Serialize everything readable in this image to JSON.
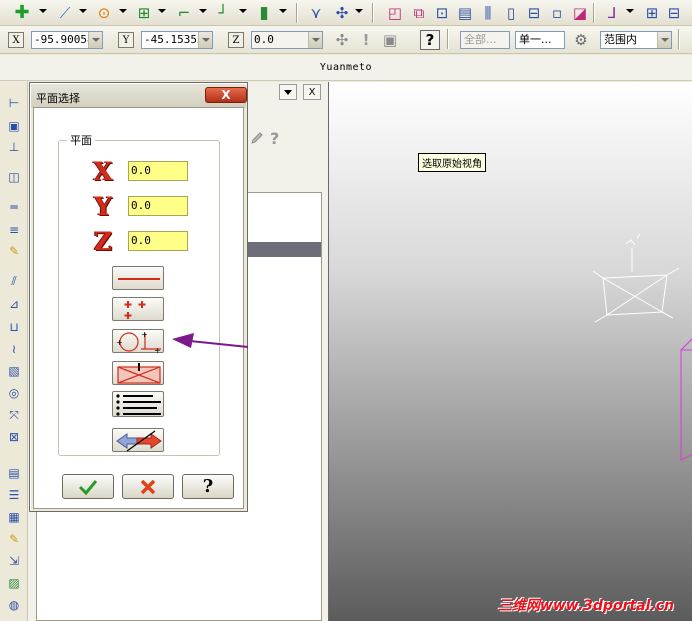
{
  "app": {
    "title": "Yuanmeto"
  },
  "toolbar1": {
    "icons": [
      "add-point-icon",
      "line-icon",
      "circle-icon",
      "grid-icon",
      "curve-icon",
      "path-icon",
      "cylinder-icon",
      "tool-icon",
      "axis-icon",
      "copy-icon",
      "transform-icon",
      "array-icon",
      "align-icon",
      "bar-icon",
      "move-icon",
      "group-icon",
      "mirror-icon",
      "corner-icon",
      "layout-icon",
      "window-icon"
    ]
  },
  "coordinates": {
    "x_label": "X",
    "x_value": "-95.90058",
    "y_label": "Y",
    "y_value": "-45.15353",
    "z_label": "Z",
    "z_value": "0.0"
  },
  "selection": {
    "filter_all": "全部...",
    "single": "单一...",
    "range": "范围内"
  },
  "dialog": {
    "title": "平面选择",
    "close_label": "X",
    "group_label": "平面",
    "x_letter": "X",
    "y_letter": "Y",
    "z_letter": "Z",
    "x_value": "0.0",
    "y_value": "0.0",
    "z_value": "0.0",
    "ok_icon": "checkmark-icon",
    "cancel_icon": "cross-icon",
    "help_label": "?"
  },
  "panel": {
    "close_label": "X",
    "help_label": "?"
  },
  "viewport": {
    "tooltip": "选取原始视角",
    "watermark": "三维网www.3dportal.cn"
  },
  "colors": {
    "highlight_input": "#ffff88",
    "axis_letter": "#d12b1a",
    "arrow": "#7a1a8c",
    "wireframe_magenta": "#d63cd6"
  }
}
